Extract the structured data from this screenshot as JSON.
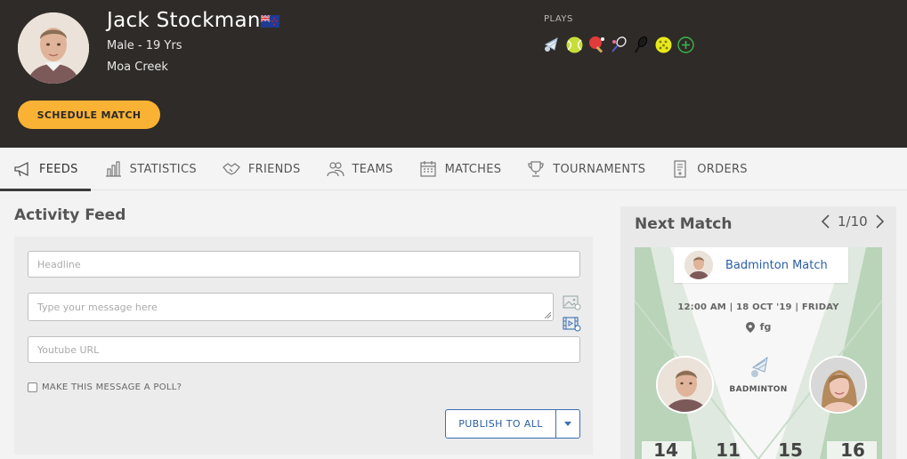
{
  "profile": {
    "name": "Jack Stockman",
    "gender_age": "Male - 19 Yrs",
    "location": "Moa Creek",
    "flag_icon": "flag-new-zealand-icon",
    "schedule_button": "SCHEDULE MATCH"
  },
  "plays": {
    "label": "PLAYS",
    "icons": [
      "badminton-icon",
      "tennis-ball-icon",
      "table-tennis-icon",
      "badminton-racket-icon",
      "squash-racket-icon",
      "pickleball-icon",
      "add-sport-icon"
    ]
  },
  "nav": {
    "items": [
      {
        "label": "FEEDS",
        "icon": "megaphone-icon",
        "active": true
      },
      {
        "label": "STATISTICS",
        "icon": "bar-chart-icon",
        "active": false
      },
      {
        "label": "FRIENDS",
        "icon": "handshake-icon",
        "active": false
      },
      {
        "label": "TEAMS",
        "icon": "team-icon",
        "active": false
      },
      {
        "label": "MATCHES",
        "icon": "calendar-icon",
        "active": false
      },
      {
        "label": "TOURNAMENTS",
        "icon": "trophy-icon",
        "active": false
      },
      {
        "label": "ORDERS",
        "icon": "receipt-icon",
        "active": false
      }
    ]
  },
  "feed": {
    "title": "Activity Feed",
    "headline_placeholder": "Headline",
    "message_placeholder": "Type your message here",
    "youtube_placeholder": "Youtube URL",
    "poll_label": "MAKE THIS MESSAGE A POLL?",
    "publish_label": "PUBLISH TO ALL"
  },
  "next_match": {
    "title": "Next Match",
    "pager": "1/10",
    "match_title": "Badminton Match",
    "datetime": "12:00 AM | 18 OCT '19 | FRIDAY",
    "venue": "fg",
    "sport": "BADMINTON",
    "scores": [
      "14",
      "11",
      "15",
      "16"
    ]
  },
  "colors": {
    "header_bg": "#2f2b28",
    "accent": "#f9b233",
    "link": "#2a5fa5"
  }
}
